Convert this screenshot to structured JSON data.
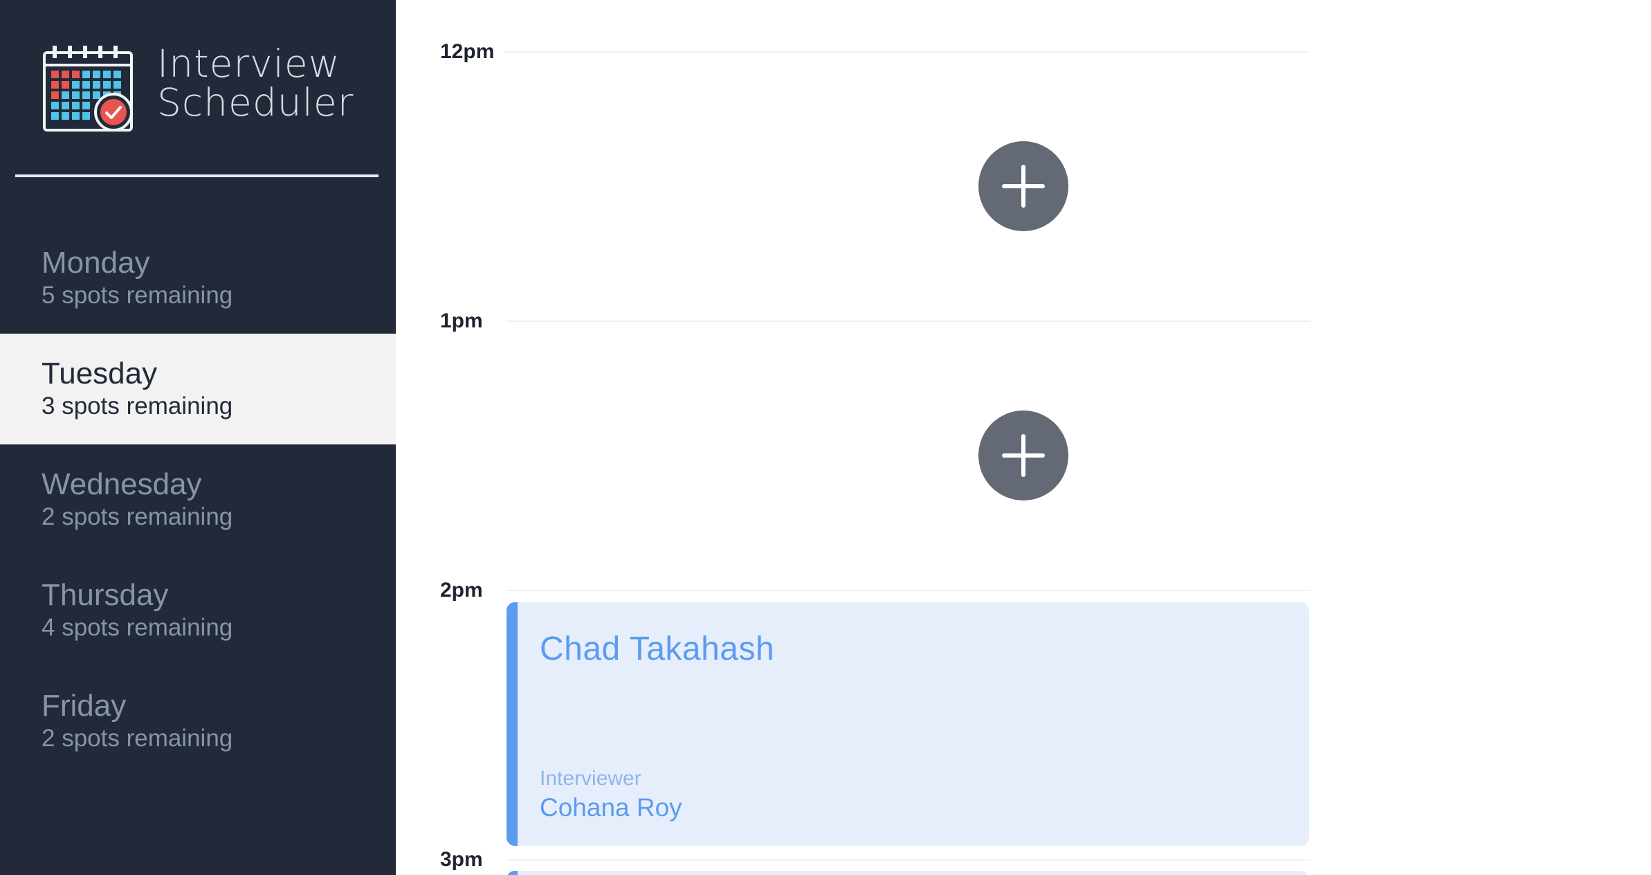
{
  "app": {
    "title_line1": "Interview",
    "title_line2": "Scheduler"
  },
  "sidebar": {
    "days": [
      {
        "name": "Monday",
        "spots": "5 spots remaining",
        "selected": false
      },
      {
        "name": "Tuesday",
        "spots": "3 spots remaining",
        "selected": true
      },
      {
        "name": "Wednesday",
        "spots": "2 spots remaining",
        "selected": false
      },
      {
        "name": "Thursday",
        "spots": "4 spots remaining",
        "selected": false
      },
      {
        "name": "Friday",
        "spots": "2 spots remaining",
        "selected": false
      }
    ]
  },
  "schedule": {
    "slots": [
      {
        "time": "12pm",
        "status": "empty"
      },
      {
        "time": "1pm",
        "status": "empty"
      },
      {
        "time": "2pm",
        "status": "booked"
      },
      {
        "time": "3pm",
        "status": "booked"
      }
    ],
    "appointment": {
      "student": "Chad Takahash",
      "interviewer_label": "Interviewer",
      "interviewer": "Cohana Roy"
    }
  },
  "icons": {
    "logo": "calendar-check-icon",
    "add": "plus-icon"
  },
  "colors": {
    "sidebar_bg": "#222a3a",
    "selected_bg": "#f2f2f2",
    "accent_blue": "#5b9bf0",
    "card_bg": "#e7eefb",
    "add_button": "#636a75",
    "logo_check": "#e8544e"
  }
}
